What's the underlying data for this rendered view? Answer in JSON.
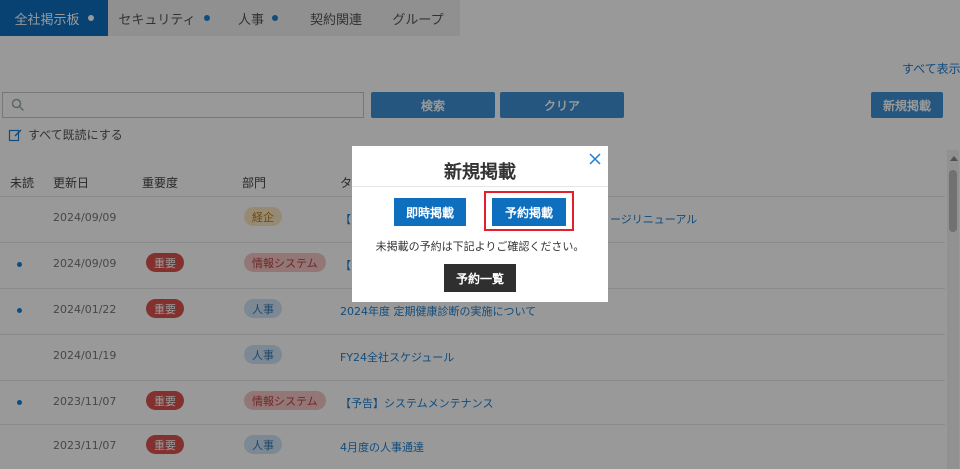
{
  "tabs": [
    {
      "label": "全社掲示板",
      "active": true,
      "has_dot": true
    },
    {
      "label": "セキュリティ",
      "active": false,
      "has_dot": true
    },
    {
      "label": "人事",
      "active": false,
      "has_dot": true
    },
    {
      "label": "契約関連",
      "active": false,
      "has_dot": false
    },
    {
      "label": "グループ",
      "active": false,
      "has_dot": false
    }
  ],
  "toolbar": {
    "show_all": "すべて表示",
    "search_placeholder": "",
    "search_button": "検索",
    "clear_button": "クリア",
    "new_post_button": "新規掲載",
    "mark_all_read": "すべて既読にする"
  },
  "table": {
    "headers": [
      "未読",
      "更新日",
      "重要度",
      "部門",
      "タ"
    ],
    "rows": [
      {
        "unread": false,
        "date": "2024/09/09",
        "importance": "",
        "category": "経企",
        "category_type": "keiei",
        "title": "【"
      },
      {
        "unread": true,
        "date": "2024/09/09",
        "importance": "重要",
        "category": "情報システム",
        "category_type": "sys",
        "title": "【"
      },
      {
        "unread": true,
        "date": "2024/01/22",
        "importance": "重要",
        "category": "人事",
        "category_type": "hr",
        "title": "2024年度 定期健康診断の実施について"
      },
      {
        "unread": false,
        "date": "2024/01/19",
        "importance": "",
        "category": "人事",
        "category_type": "hr",
        "title": "FY24全社スケジュール"
      },
      {
        "unread": true,
        "date": "2023/11/07",
        "importance": "重要",
        "category": "情報システム",
        "category_type": "sys",
        "title": "【予告】システムメンテナンス"
      },
      {
        "unread": false,
        "date": "2023/11/07",
        "importance": "重要",
        "category": "人事",
        "category_type": "hr",
        "title": "4月度の人事通達"
      }
    ],
    "partial_title_text": "ージリニューアル"
  },
  "modal": {
    "title": "新規掲載",
    "instant_button": "即時掲載",
    "scheduled_button": "予約掲載",
    "note": "未掲載の予約は下記よりご確認ください。",
    "list_button": "予約一覧"
  },
  "colors": {
    "primary": "#0e6fbf",
    "highlight": "#e21f2a",
    "important": "#d9534f",
    "dark_button": "#2f2f2f"
  },
  "icons": {
    "search": "search-icon",
    "mark_read": "mark-read-icon",
    "close": "close-icon"
  }
}
